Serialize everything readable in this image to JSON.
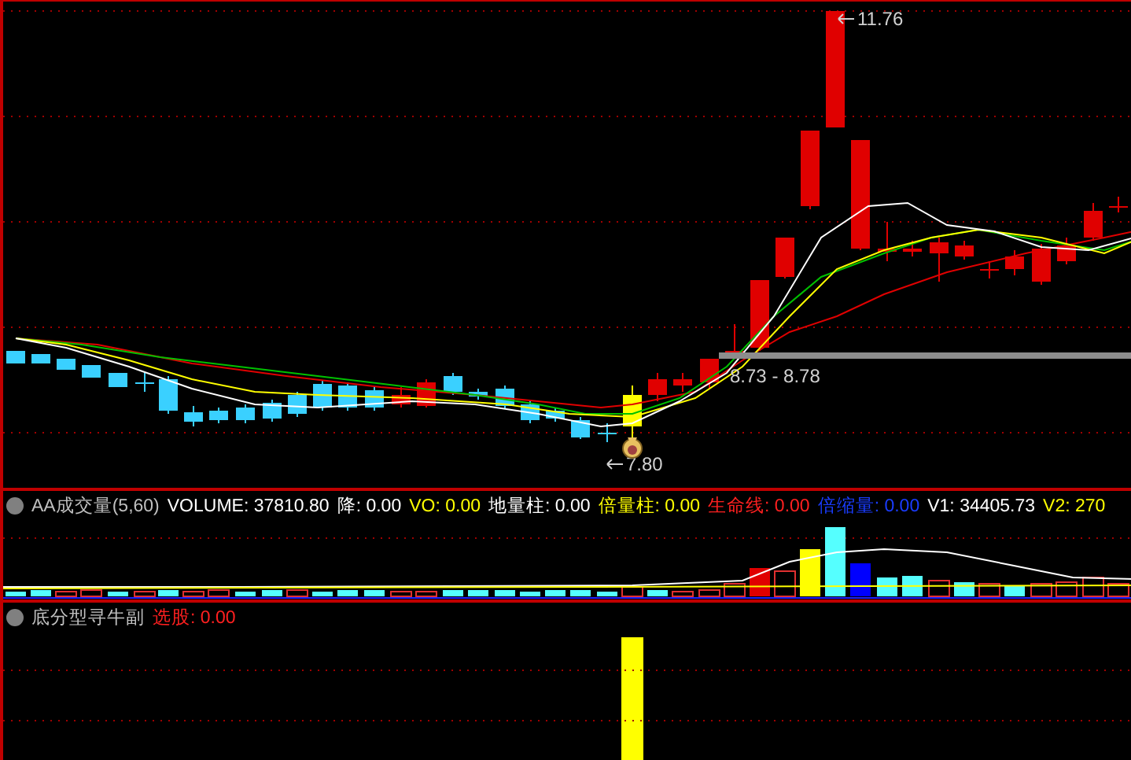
{
  "price_panel": {
    "high_label": "11.76",
    "low_label": "7.80",
    "range_label": "8.73 - 8.78"
  },
  "volume_panel": {
    "title": "AA成交量(5,60)",
    "legend": [
      {
        "text": "VOLUME: 37810.80",
        "color": "#ffffff"
      },
      {
        "text": "降: 0.00",
        "color": "#ffffff"
      },
      {
        "text": "VO: 0.00",
        "color": "#ffff00"
      },
      {
        "text": "地量柱: 0.00",
        "color": "#ffffff"
      },
      {
        "text": "倍量柱: 0.00",
        "color": "#ffff00"
      },
      {
        "text": "生命线: 0.00",
        "color": "#ff2020"
      },
      {
        "text": "倍缩量: 0.00",
        "color": "#1a3cff"
      },
      {
        "text": "V1: 34405.73",
        "color": "#ffffff"
      },
      {
        "text": "V2: 270",
        "color": "#ffff00"
      }
    ]
  },
  "indicator_panel": {
    "title": "底分型寻牛副",
    "legend": [
      {
        "text": "选股: 0.00",
        "color": "#ff2020"
      }
    ]
  }
}
